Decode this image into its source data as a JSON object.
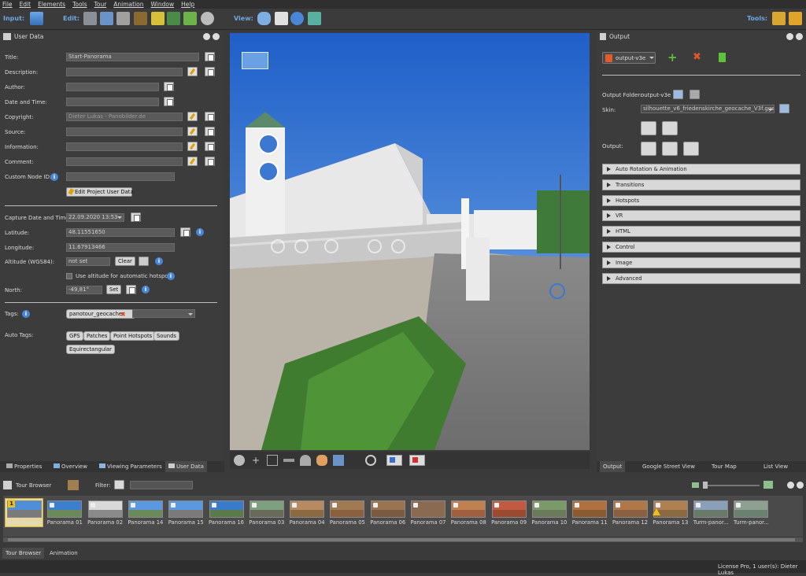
{
  "menu": [
    "File",
    "Edit",
    "Elements",
    "Tools",
    "Tour",
    "Animation",
    "Window",
    "Help"
  ],
  "toolbar": {
    "input_label": "Input:",
    "edit_label": "Edit:",
    "view_label": "View:",
    "tools_label": "Tools:"
  },
  "user_data": {
    "title": "User Data",
    "fields": [
      {
        "label": "Title:",
        "value": "Start-Panorama"
      },
      {
        "label": "Description:",
        "value": ""
      },
      {
        "label": "Author:",
        "value": ""
      },
      {
        "label": "Date and Time:",
        "value": ""
      },
      {
        "label": "Copyright:",
        "value": "Dieter Lukas - Panobilder.de"
      },
      {
        "label": "Source:",
        "value": ""
      },
      {
        "label": "Information:",
        "value": ""
      },
      {
        "label": "Comment:",
        "value": ""
      },
      {
        "label": "Custom Node ID:",
        "value": ""
      }
    ],
    "edit_project_btn": "Edit Project User Data",
    "capture_label": "Capture Date and Time:",
    "capture_value": "22.09.2020 13:53",
    "latitude_label": "Latitude:",
    "latitude_value": "48.11551650",
    "longitude_label": "Longitude:",
    "longitude_value": "11.67913466",
    "altitude_label": "Altitude (WGS84):",
    "altitude_value": "not set",
    "clear_btn": "Clear",
    "use_altitude_label": "Use altitude for automatic hotspots",
    "north_label": "North:",
    "north_value": "-49,81°",
    "set_btn": "Set",
    "tags_label": "Tags:",
    "tag_value": "panotour_geocacher",
    "auto_tags_label": "Auto Tags:",
    "auto_tags": [
      "GPS",
      "Patches",
      "Point Hotspots",
      "Sounds",
      "Equirectangular"
    ]
  },
  "left_tabs": [
    "Properties",
    "Overview",
    "Viewing Parameters",
    "User Data"
  ],
  "output": {
    "title": "Output",
    "format": "output-v3e",
    "folder_label": "Output Folder:",
    "folder_value": "output-v3e",
    "skin_label": "Skin:",
    "skin_value": "silhouette_v6_friedenskirche_geocache_V3f.ggsk",
    "output_label": "Output:",
    "sections": [
      "Auto Rotation & Animation",
      "Transitions",
      "Hotspots",
      "VR",
      "HTML",
      "Control",
      "Image",
      "Advanced"
    ]
  },
  "right_tabs": [
    "Output",
    "Google Street View",
    "Tour Map",
    "List View"
  ],
  "tour_browser": {
    "title": "Tour Browser",
    "filter_label": "Filter:",
    "thumbs": [
      "Start-Panor...",
      "Panorama 01",
      "Panorama 02",
      "Panorama 14",
      "Panorama 15",
      "Panorama 16",
      "Panorama 03",
      "Panorama 04",
      "Panorama 05",
      "Panorama 06",
      "Panorama 07",
      "Panorama 08",
      "Panorama 09",
      "Panorama 10",
      "Panorama 11",
      "Panorama 12",
      "Panorama 13",
      "Turm-panor...",
      "Turm-panor..."
    ]
  },
  "bottom_tabs": [
    "Tour Browser",
    "Animation"
  ],
  "status": "License Pro, 1 user(s): Dieter Lukas",
  "colors": {
    "accent": "#6fa6e0",
    "info": "#4a86d6",
    "sky": "#2a6fd0"
  }
}
